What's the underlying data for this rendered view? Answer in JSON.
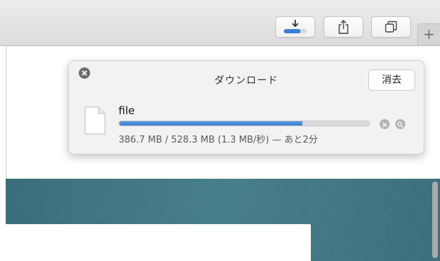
{
  "toolbar": {
    "download_icon": "download-progress-icon",
    "share_icon": "share-icon",
    "tabs_icon": "tab-overview-icon",
    "new_tab_label": "+",
    "download_progress": 0.732
  },
  "downloads": {
    "title": "ダウンロード",
    "clear_label": "消去",
    "close_icon": "close-icon",
    "items": [
      {
        "name": "file",
        "status": "386.7 MB / 528.3 MB (1.3 MB/秒) — あと2分",
        "progress": 0.732,
        "stop_icon": "stop-icon",
        "reveal_icon": "magnifier-icon"
      }
    ]
  },
  "colors": {
    "accent": "#3b7fd0",
    "banner": "#477f8a",
    "popover_bg": "#f2f2f2"
  }
}
